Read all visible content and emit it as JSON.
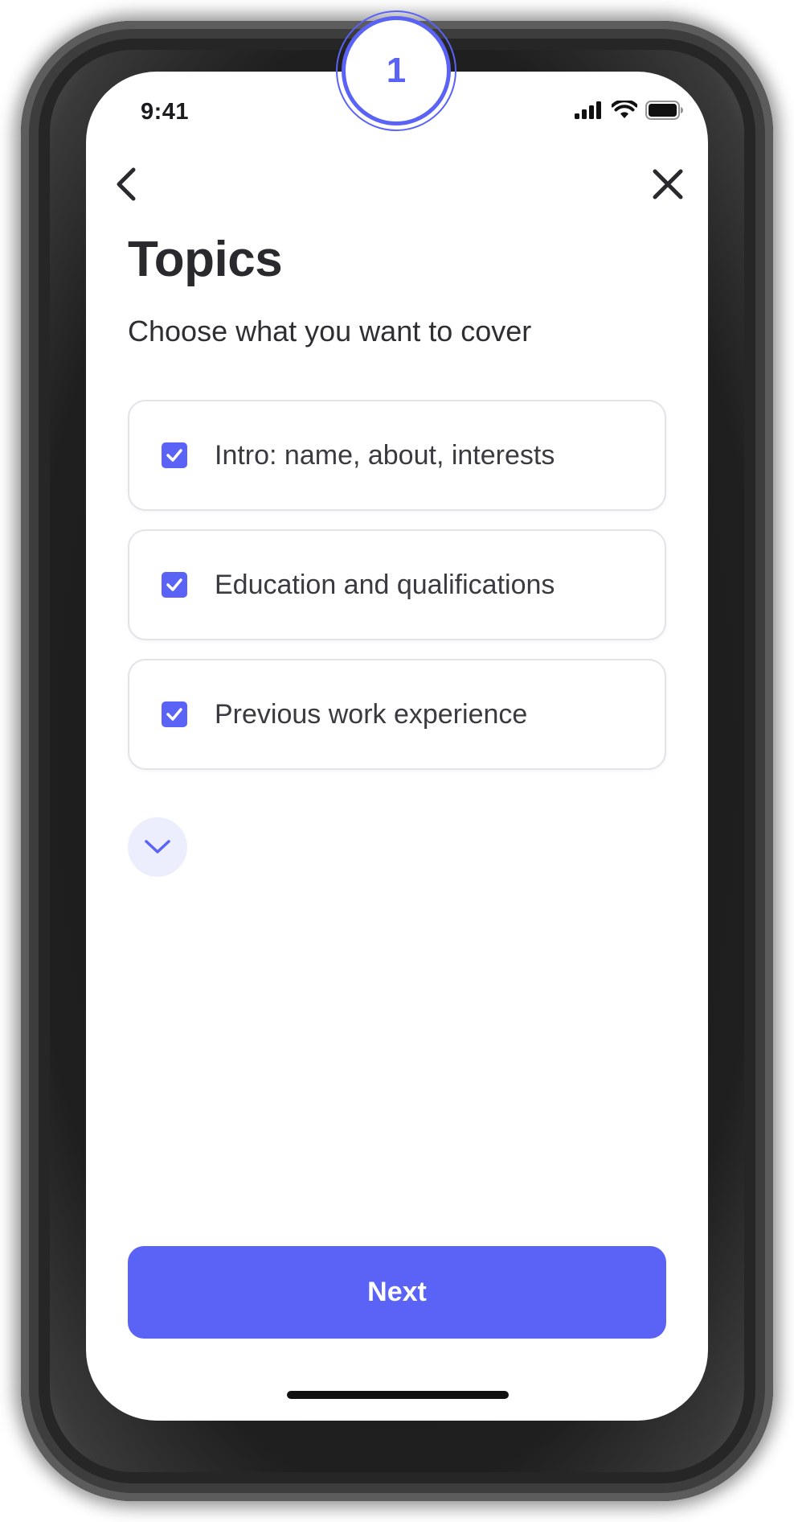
{
  "status_bar": {
    "time": "9:41",
    "icons": [
      "cellular-signal-icon",
      "wifi-icon",
      "battery-icon"
    ]
  },
  "step_badge": {
    "number": "1"
  },
  "nav": {
    "back_icon": "chevron-left-icon",
    "close_icon": "close-icon"
  },
  "page": {
    "title": "Topics",
    "subtitle": "Choose what you want to cover"
  },
  "topics": [
    {
      "label": "Intro: name, about, interests",
      "checked": true
    },
    {
      "label": "Education and qualifications",
      "checked": true
    },
    {
      "label": "Previous work experience",
      "checked": true
    }
  ],
  "expand": {
    "icon": "chevron-down-icon"
  },
  "next_button": {
    "label": "Next"
  },
  "colors": {
    "accent": "#5a63f5",
    "accent_light": "#eceefe",
    "text_primary": "#2a2a2e",
    "card_border": "#e3e3e8"
  }
}
